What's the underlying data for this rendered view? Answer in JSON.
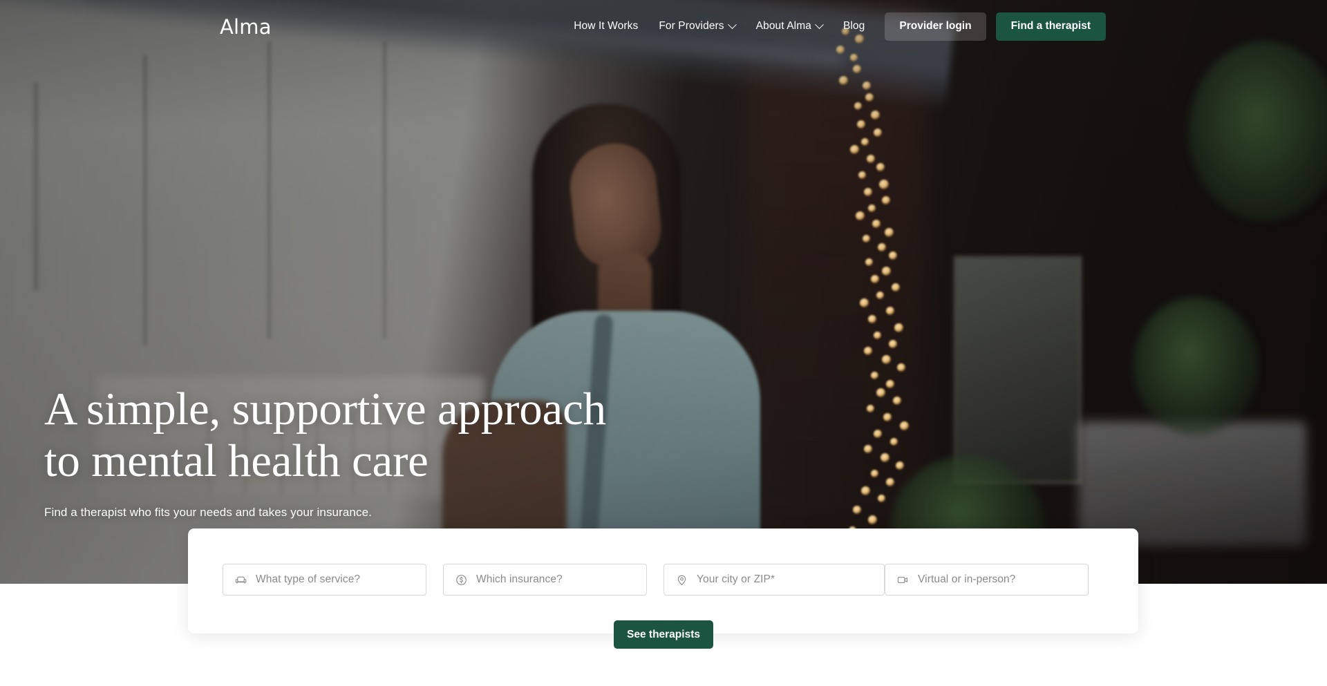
{
  "brand": {
    "logo_text": "Alma",
    "green": "#1b5440",
    "ghost_button_bg": "rgba(255,255,255,0.17)"
  },
  "nav": {
    "links": [
      {
        "label": "How It Works",
        "has_chevron": false,
        "icon": ""
      },
      {
        "label": "For Providers",
        "has_chevron": true,
        "icon": "chevron-down-icon"
      },
      {
        "label": "About Alma",
        "has_chevron": true,
        "icon": "chevron-down-icon"
      },
      {
        "label": "Blog",
        "has_chevron": false,
        "icon": ""
      }
    ],
    "provider_login_label": "Provider login",
    "find_therapist_label": "Find a therapist"
  },
  "hero": {
    "headline_line1": "A simple, supportive approach",
    "headline_line2": "to mental health care",
    "subheadline": "Find a therapist who fits your needs and takes your insurance."
  },
  "search": {
    "fields": [
      {
        "icon": "armchair-icon",
        "placeholder": "What type of service?",
        "value": ""
      },
      {
        "icon": "dollar-circle-icon",
        "placeholder": "Which insurance?",
        "value": ""
      },
      {
        "icon": "location-pin-icon",
        "placeholder": "Your city or ZIP*",
        "value": ""
      },
      {
        "icon": "video-camera-icon",
        "placeholder": "Virtual or in-person?",
        "value": ""
      }
    ],
    "submit_label": "See therapists"
  }
}
